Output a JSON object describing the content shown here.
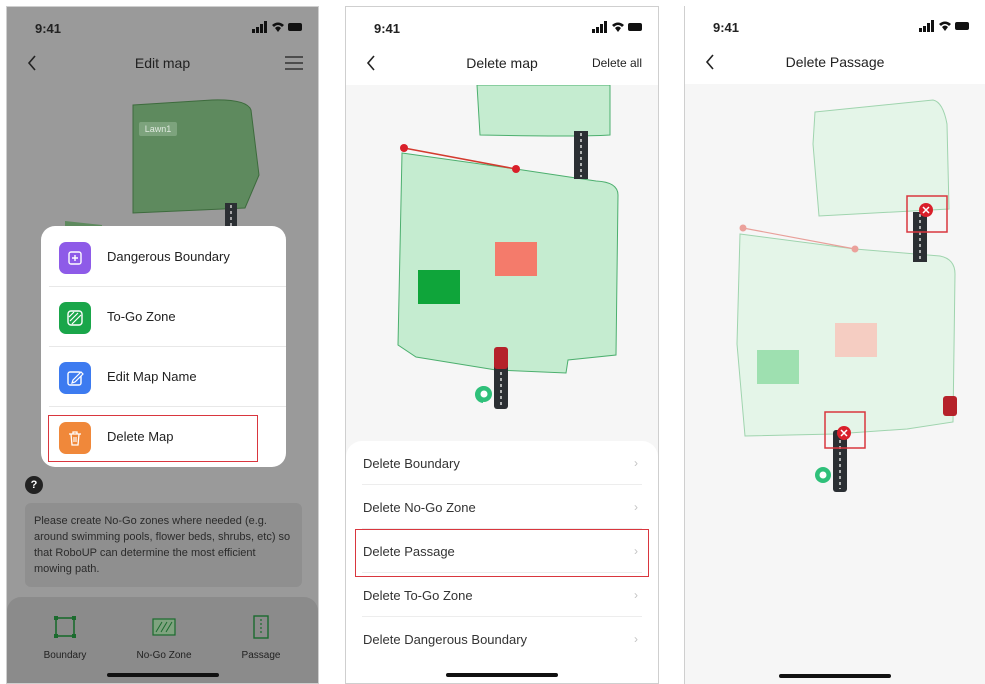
{
  "screen1": {
    "time": "9:41",
    "title": "Edit map",
    "map_label": "Lawn1",
    "menu": [
      {
        "label": "Dangerous Boundary",
        "color": "#8e5be8"
      },
      {
        "label": "To-Go Zone",
        "color": "#1aa64a"
      },
      {
        "label": "Edit Map Name",
        "color": "#3d7bf0"
      },
      {
        "label": "Delete Map",
        "color": "#f0883a"
      }
    ],
    "help_glyph": "?",
    "tip": "Please create No-Go zones where needed (e.g. around swimming pools, flower beds, shrubs, etc) so that  RoboUP can determine the most efficient mowing path.",
    "tools": [
      {
        "label": "Boundary",
        "icon": "boundary-icon"
      },
      {
        "label": "No-Go Zone",
        "icon": "no-go-zone-icon"
      },
      {
        "label": "Passage",
        "icon": "passage-icon"
      }
    ]
  },
  "screen2": {
    "time": "9:41",
    "title": "Delete map",
    "action": "Delete all",
    "options": [
      {
        "label": "Delete Boundary"
      },
      {
        "label": "Delete No-Go Zone"
      },
      {
        "label": "Delete Passage"
      },
      {
        "label": "Delete To-Go Zone"
      },
      {
        "label": "Delete Dangerous Boundary"
      }
    ],
    "chevron": "›"
  },
  "screen3": {
    "time": "9:41",
    "title": "Delete Passage"
  },
  "colors": {
    "lawn_fill": "#c5ecd0",
    "lawn_stroke": "#4caf6e",
    "no_go": "#f47b6b",
    "to_go": "#0fa53a",
    "highlight": "#d9363e",
    "pin": "#2fc07a"
  }
}
